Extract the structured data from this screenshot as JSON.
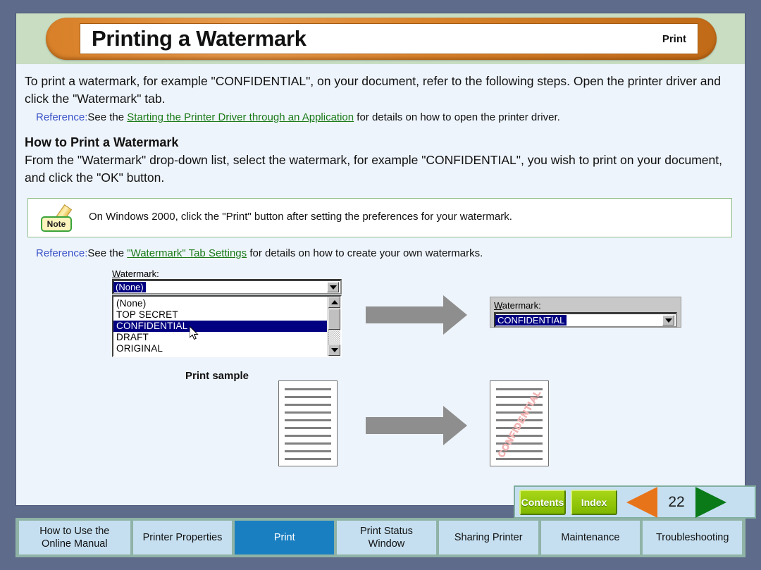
{
  "header": {
    "title": "Printing a Watermark",
    "section": "Print"
  },
  "body": {
    "intro": "To print a watermark, for example \"CONFIDENTIAL\", on your document, refer to the following steps. Open the printer driver and click the \"Watermark\" tab.",
    "reference1": {
      "label": "Reference:",
      "before": "See the ",
      "link": "Starting the Printer Driver through an Application",
      "after": " for details on how to open the printer driver."
    },
    "subheading": "How to Print a Watermark",
    "instruction": "From the \"Watermark\" drop-down list, select the watermark, for example \"CONFIDENTIAL\", you wish to print on your document, and click the \"OK\" button.",
    "note": {
      "badge": "Note",
      "text": "On Windows 2000, click the \"Print\" button after setting the preferences for your watermark."
    },
    "reference2": {
      "label": "Reference:",
      "before": "See the ",
      "link": "\"Watermark\" Tab Settings",
      "after": " for details on how to create your own watermarks."
    }
  },
  "dialog_before": {
    "field_label": "Watermark:",
    "field_label_accel": "W",
    "field_label_rest": "atermark:",
    "selected_value": "(None)",
    "options": [
      "(None)",
      "TOP SECRET",
      "CONFIDENTIAL",
      "DRAFT",
      "ORIGINAL"
    ],
    "highlighted_option": "CONFIDENTIAL"
  },
  "dialog_after": {
    "field_label_accel": "W",
    "field_label_rest": "atermark:",
    "selected_value": "CONFIDENTIAL"
  },
  "print_sample": {
    "label": "Print sample",
    "watermark_text": "CONFIDENTIAL",
    "line_count": 10
  },
  "nav": {
    "contents": "Contents",
    "index": "Index",
    "page_number": "22"
  },
  "tabs": [
    {
      "label": "How to Use the\nOnline Manual",
      "active": false
    },
    {
      "label": "Printer Properties",
      "active": false
    },
    {
      "label": "Print",
      "active": true
    },
    {
      "label": "Print Status\nWindow",
      "active": false
    },
    {
      "label": "Sharing Printer",
      "active": false
    },
    {
      "label": "Maintenance",
      "active": false
    },
    {
      "label": "Troubleshooting",
      "active": false
    }
  ],
  "colors": {
    "page_background": "#5f6b8a",
    "header_band": "#c8ddc2",
    "content_background": "#eef4fb",
    "accent_orange": "#d9822b",
    "active_tab": "#1a7fc1",
    "tab": "#c5dff0",
    "link_green": "#1a7a18",
    "reference_blue": "#3a53c8",
    "watermark_red": "#f3b9b9"
  }
}
